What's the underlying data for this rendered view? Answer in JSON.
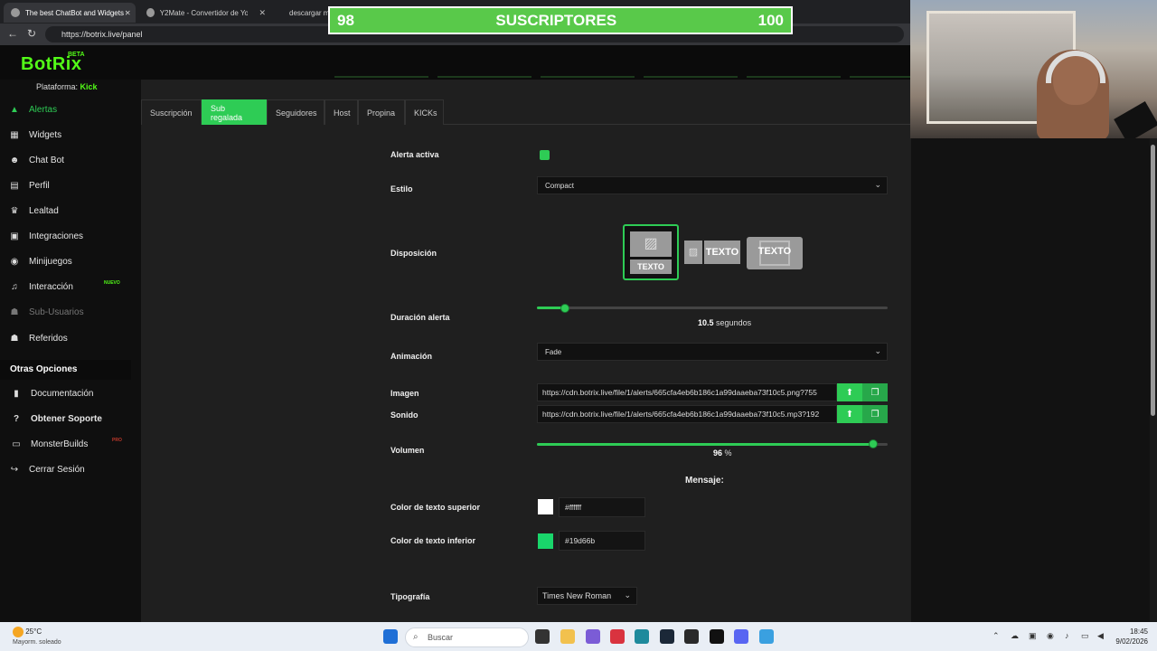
{
  "browser": {
    "tabs": [
      {
        "title": "The best ChatBot and Widgets for",
        "active": true
      },
      {
        "title": "Y2Mate - Convertidor de YouTube",
        "active": false
      },
      {
        "title": "descargar m",
        "active": false
      }
    ],
    "url": "https://botrix.live/panel"
  },
  "overlay": {
    "current": "98",
    "label": "SUSCRIPTORES",
    "goal": "100"
  },
  "app": {
    "logo": "BotRix",
    "beta": "BETA",
    "platform_label": "Plataforma:",
    "platform_value": "Kick",
    "sidebar": {
      "items": [
        {
          "label": "Alertas",
          "icon": "warning-icon"
        },
        {
          "label": "Widgets",
          "icon": "grid-icon"
        },
        {
          "label": "Chat Bot",
          "icon": "robot-icon"
        },
        {
          "label": "Perfil",
          "icon": "id-card-icon"
        },
        {
          "label": "Lealtad",
          "icon": "trophy-icon"
        },
        {
          "label": "Integraciones",
          "icon": "plug-icon"
        },
        {
          "label": "Minijuegos",
          "icon": "gamepad-icon"
        },
        {
          "label": "Interacción",
          "icon": "music-icon"
        },
        {
          "label": "Sub-Usuarios",
          "icon": "users-icon"
        },
        {
          "label": "Referidos",
          "icon": "user-group-icon"
        }
      ],
      "nuevo_badge": "NUEVO",
      "other_title": "Otras Opciones",
      "other_items": [
        {
          "label": "Documentación",
          "icon": "book-icon"
        },
        {
          "label": "Obtener Soporte",
          "icon": "help-icon"
        },
        {
          "label": "MonsterBuilds",
          "icon": "laptop-icon"
        },
        {
          "label": "Cerrar Sesión",
          "icon": "logout-icon"
        }
      ],
      "pro_badge": "PRO"
    },
    "tabs": [
      "Suscripción",
      "Sub regalada",
      "Seguidores",
      "Host",
      "Propina",
      "KICKs"
    ],
    "active_tab": "Sub regalada",
    "form": {
      "alerta_activa_label": "Alerta activa",
      "alerta_activa": true,
      "estilo_label": "Estilo",
      "estilo_value": "Compact",
      "disposicion_label": "Disposición",
      "layout_text": "TEXTO",
      "duracion_label": "Duración alerta",
      "duracion_value": "10.5",
      "duracion_unit": "segundos",
      "duracion_fraction": 0.08,
      "animacion_label": "Animación",
      "animacion_value": "Fade",
      "imagen_label": "Imagen",
      "imagen_url": "https://cdn.botrix.live/file/1/alerts/665cfa4eb6b186c1a99daaeba73f10c5.png?755",
      "sonido_label": "Sonido",
      "sonido_url": "https://cdn.botrix.live/file/1/alerts/665cfa4eb6b186c1a99daaeba73f10c5.mp3?192",
      "volumen_label": "Volumen",
      "volumen_value": "96",
      "volumen_unit": "%",
      "volumen_fraction": 0.96,
      "mensaje_title": "Mensaje:",
      "color_superior_label": "Color de texto superior",
      "color_superior": "#ffffff",
      "color_inferior_label": "Color de texto inferior",
      "color_inferior": "#19d66b",
      "tipografia_label": "Tipografía",
      "tipografia_value": "Times New Roman"
    }
  },
  "taskbar": {
    "temp": "25°C",
    "weather": "Mayorm. soleado",
    "search_placeholder": "Buscar",
    "time": "18:45",
    "date": "9/02/2026"
  },
  "colors": {
    "accent": "#2ecc55",
    "kick_green": "#53fc18",
    "overlay_green": "#59c94a"
  }
}
